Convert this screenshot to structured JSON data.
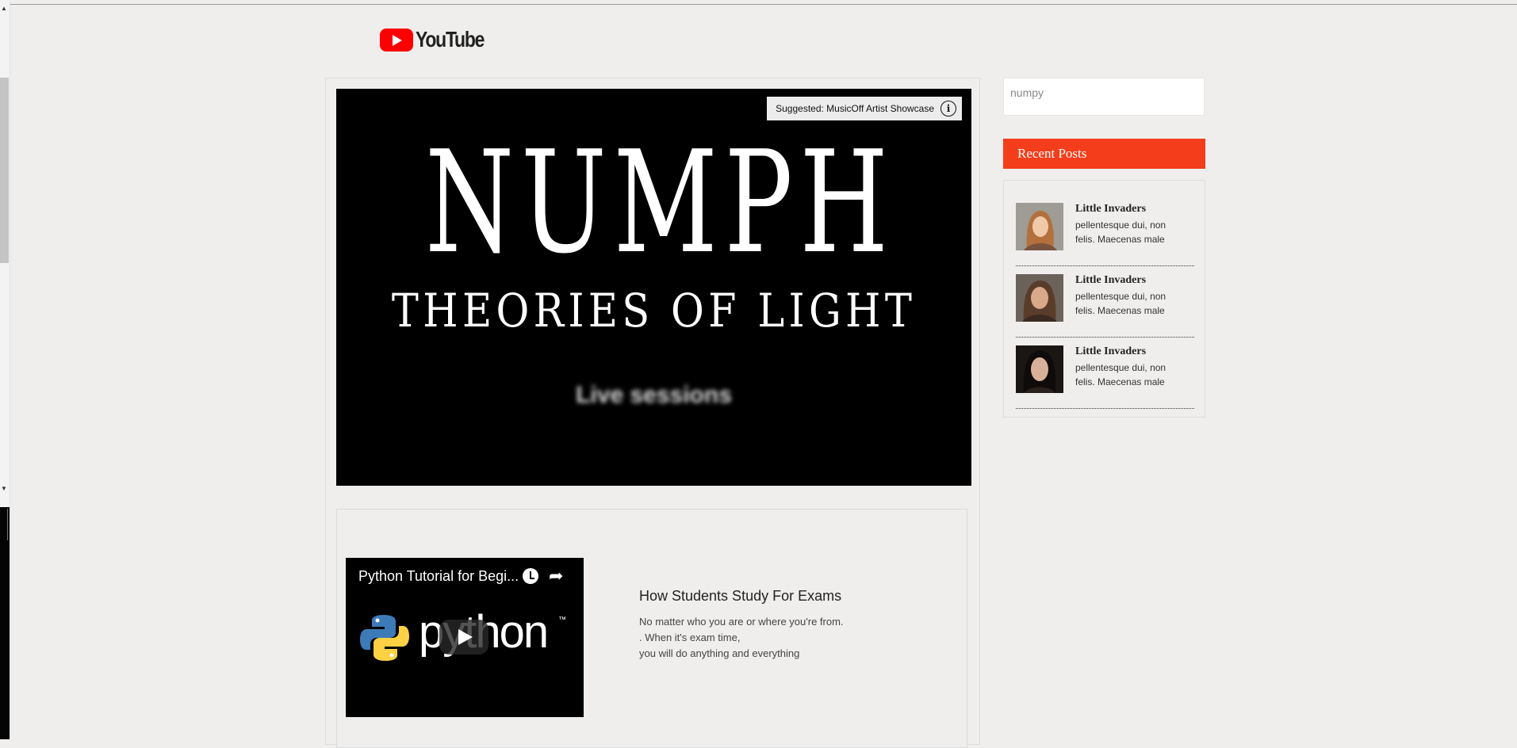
{
  "header": {
    "logo_text": "YouTube"
  },
  "player": {
    "suggestion": "Suggested: MusicOff Artist Showcase",
    "info_icon": "i",
    "title_line1": "NUMPH",
    "title_line2": "THEORIES OF LIGHT",
    "title_line3": "Live sessions"
  },
  "featured_post": {
    "video_title": "Python Tutorial for Begi...",
    "logo_word": "python",
    "trademark": "™",
    "title": "How Students Study For Exams",
    "description": "No matter who you are or where you're from.\n. When it's exam time,\nyou will do anything and everything"
  },
  "sidebar": {
    "search_value": "numpy",
    "recent_heading": "Recent Posts",
    "posts": [
      {
        "title": "Little Invaders",
        "excerpt": "pellentesque dui, non felis. Maecenas male"
      },
      {
        "title": "Little Invaders",
        "excerpt": "pellentesque dui, non felis. Maecenas male"
      },
      {
        "title": "Little Invaders",
        "excerpt": "pellentesque dui, non felis. Maecenas male"
      }
    ]
  },
  "colors": {
    "accent": "#f43d1a",
    "youtube_red": "#ff0000"
  },
  "icons": [
    "youtube-logo-icon",
    "info-icon",
    "clock-icon",
    "share-icon",
    "python-logo-icon",
    "play-icon"
  ]
}
